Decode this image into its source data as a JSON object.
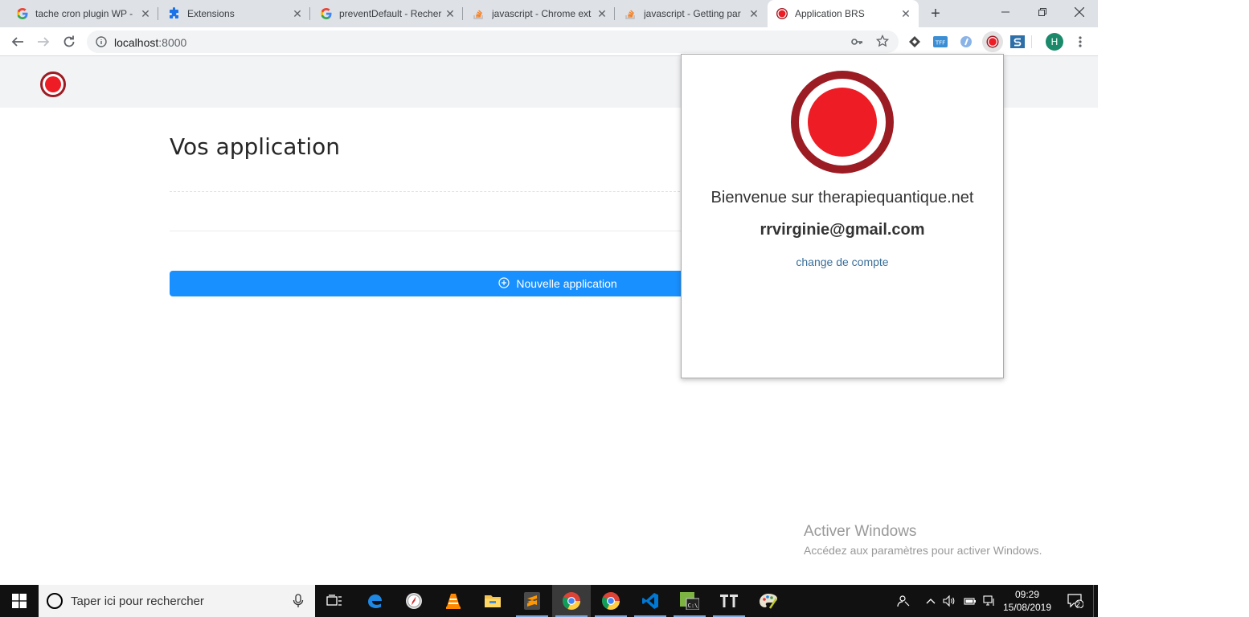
{
  "browser": {
    "tabs": [
      {
        "title": "tache cron plugin WP -",
        "icon": "google-icon"
      },
      {
        "title": "Extensions",
        "icon": "puzzle-icon"
      },
      {
        "title": "preventDefault - Recher",
        "icon": "google-icon"
      },
      {
        "title": "javascript - Chrome ext",
        "icon": "stackoverflow-icon"
      },
      {
        "title": "javascript - Getting par",
        "icon": "stackoverflow-icon"
      },
      {
        "title": "Application BRS",
        "icon": "record-icon"
      }
    ],
    "url_host": "localhost",
    "url_port": ":8000",
    "profile_initial": "H"
  },
  "page": {
    "heading": "Vos application",
    "new_app_label": "Nouvelle application",
    "activate_title": "Activer Windows",
    "activate_subtitle": "Accédez aux paramètres pour activer Windows."
  },
  "popup": {
    "welcome": "Bienvenue sur therapiequantique.net",
    "email": "rrvirginie@gmail.com",
    "switch_account": "change de compte"
  },
  "taskbar": {
    "search_placeholder": "Taper ici pour rechercher",
    "time": "09:29",
    "date": "15/08/2019",
    "notification_count": "2"
  },
  "colors": {
    "primary": "#1890ff",
    "logo_red": "#ee1c25",
    "logo_dark_red": "#9c1c24",
    "link": "#3a6f9a"
  }
}
